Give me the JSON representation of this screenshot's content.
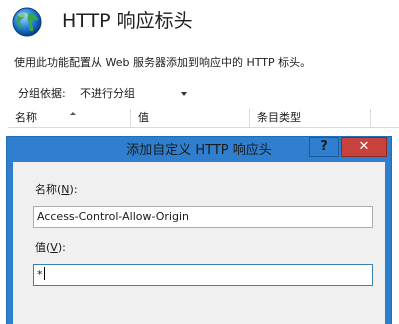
{
  "header": {
    "title": "HTTP 响应标头",
    "icon": "globe-icon",
    "description": "使用此功能配置从 Web 服务器添加到响应中的 HTTP 标头。"
  },
  "toolbar": {
    "group_by_label": "分组依据:",
    "group_by_value": "不进行分组"
  },
  "grid": {
    "columns": [
      "名称",
      "值",
      "条目类型"
    ]
  },
  "dialog": {
    "title": "添加自定义 HTTP 响应头",
    "help_label": "?",
    "close_label": "✕",
    "name_label": "名称(",
    "name_accel": "N",
    "name_label_end": "):",
    "name_value": "Access-Control-Allow-Origin",
    "value_label": "值(",
    "value_accel": "V",
    "value_label_end": "):",
    "value_value": "*"
  },
  "colors": {
    "dialog_frame": "#2f7fce",
    "close_button": "#c7423c",
    "dialog_body": "#f0f0f0"
  }
}
